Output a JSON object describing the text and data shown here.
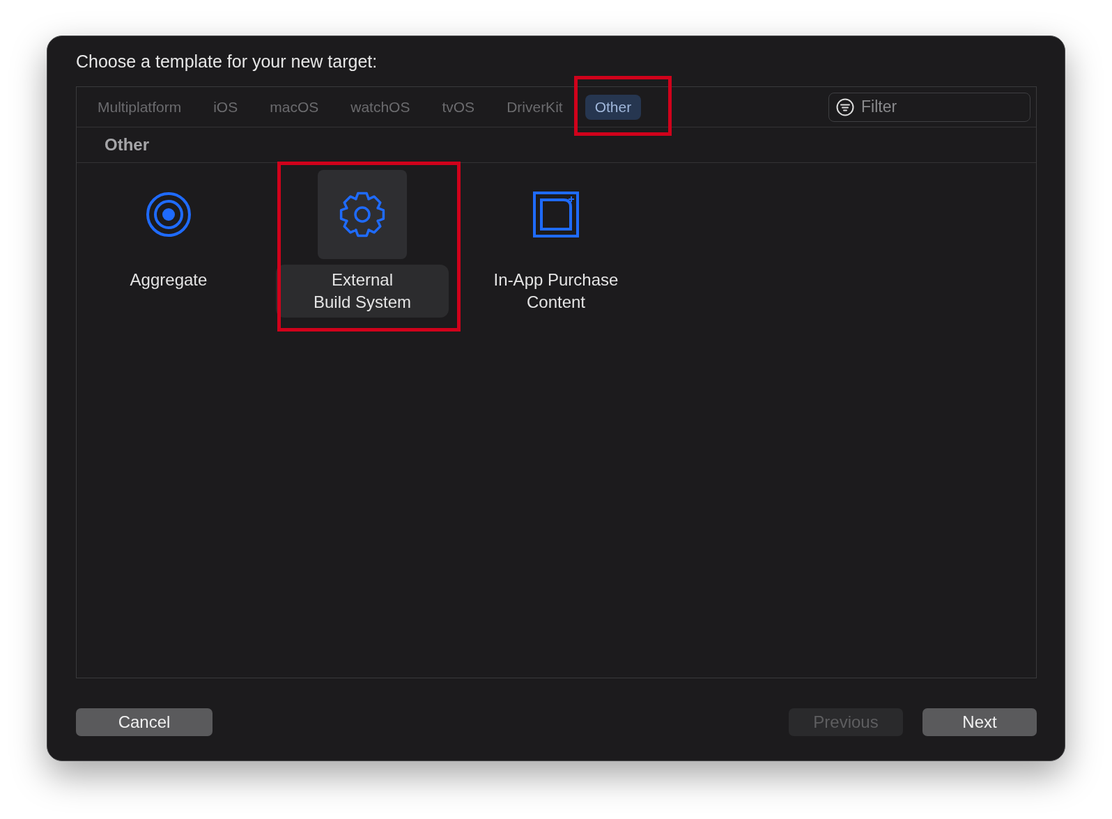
{
  "dialog": {
    "title": "Choose a template for your new target:"
  },
  "tabs": [
    {
      "label": "Multiplatform",
      "selected": false,
      "highlighted": false
    },
    {
      "label": "iOS",
      "selected": false,
      "highlighted": false
    },
    {
      "label": "macOS",
      "selected": false,
      "highlighted": false
    },
    {
      "label": "watchOS",
      "selected": false,
      "highlighted": false
    },
    {
      "label": "tvOS",
      "selected": false,
      "highlighted": false
    },
    {
      "label": "DriverKit",
      "selected": false,
      "highlighted": false
    },
    {
      "label": "Other",
      "selected": true,
      "highlighted": true
    }
  ],
  "filter": {
    "placeholder": "Filter"
  },
  "section": {
    "title": "Other"
  },
  "templates": [
    {
      "kind": "target",
      "lines": [
        "Aggregate"
      ],
      "selected": false,
      "highlighted": false
    },
    {
      "kind": "gear",
      "lines": [
        "External",
        "Build System"
      ],
      "selected": true,
      "highlighted": true
    },
    {
      "kind": "package",
      "lines": [
        "In-App Purchase",
        "Content"
      ],
      "selected": false,
      "highlighted": false
    }
  ],
  "buttons": [
    {
      "label": "Cancel",
      "disabled": false
    },
    {
      "label": "Previous",
      "disabled": true
    },
    {
      "label": "Next",
      "disabled": false
    }
  ]
}
